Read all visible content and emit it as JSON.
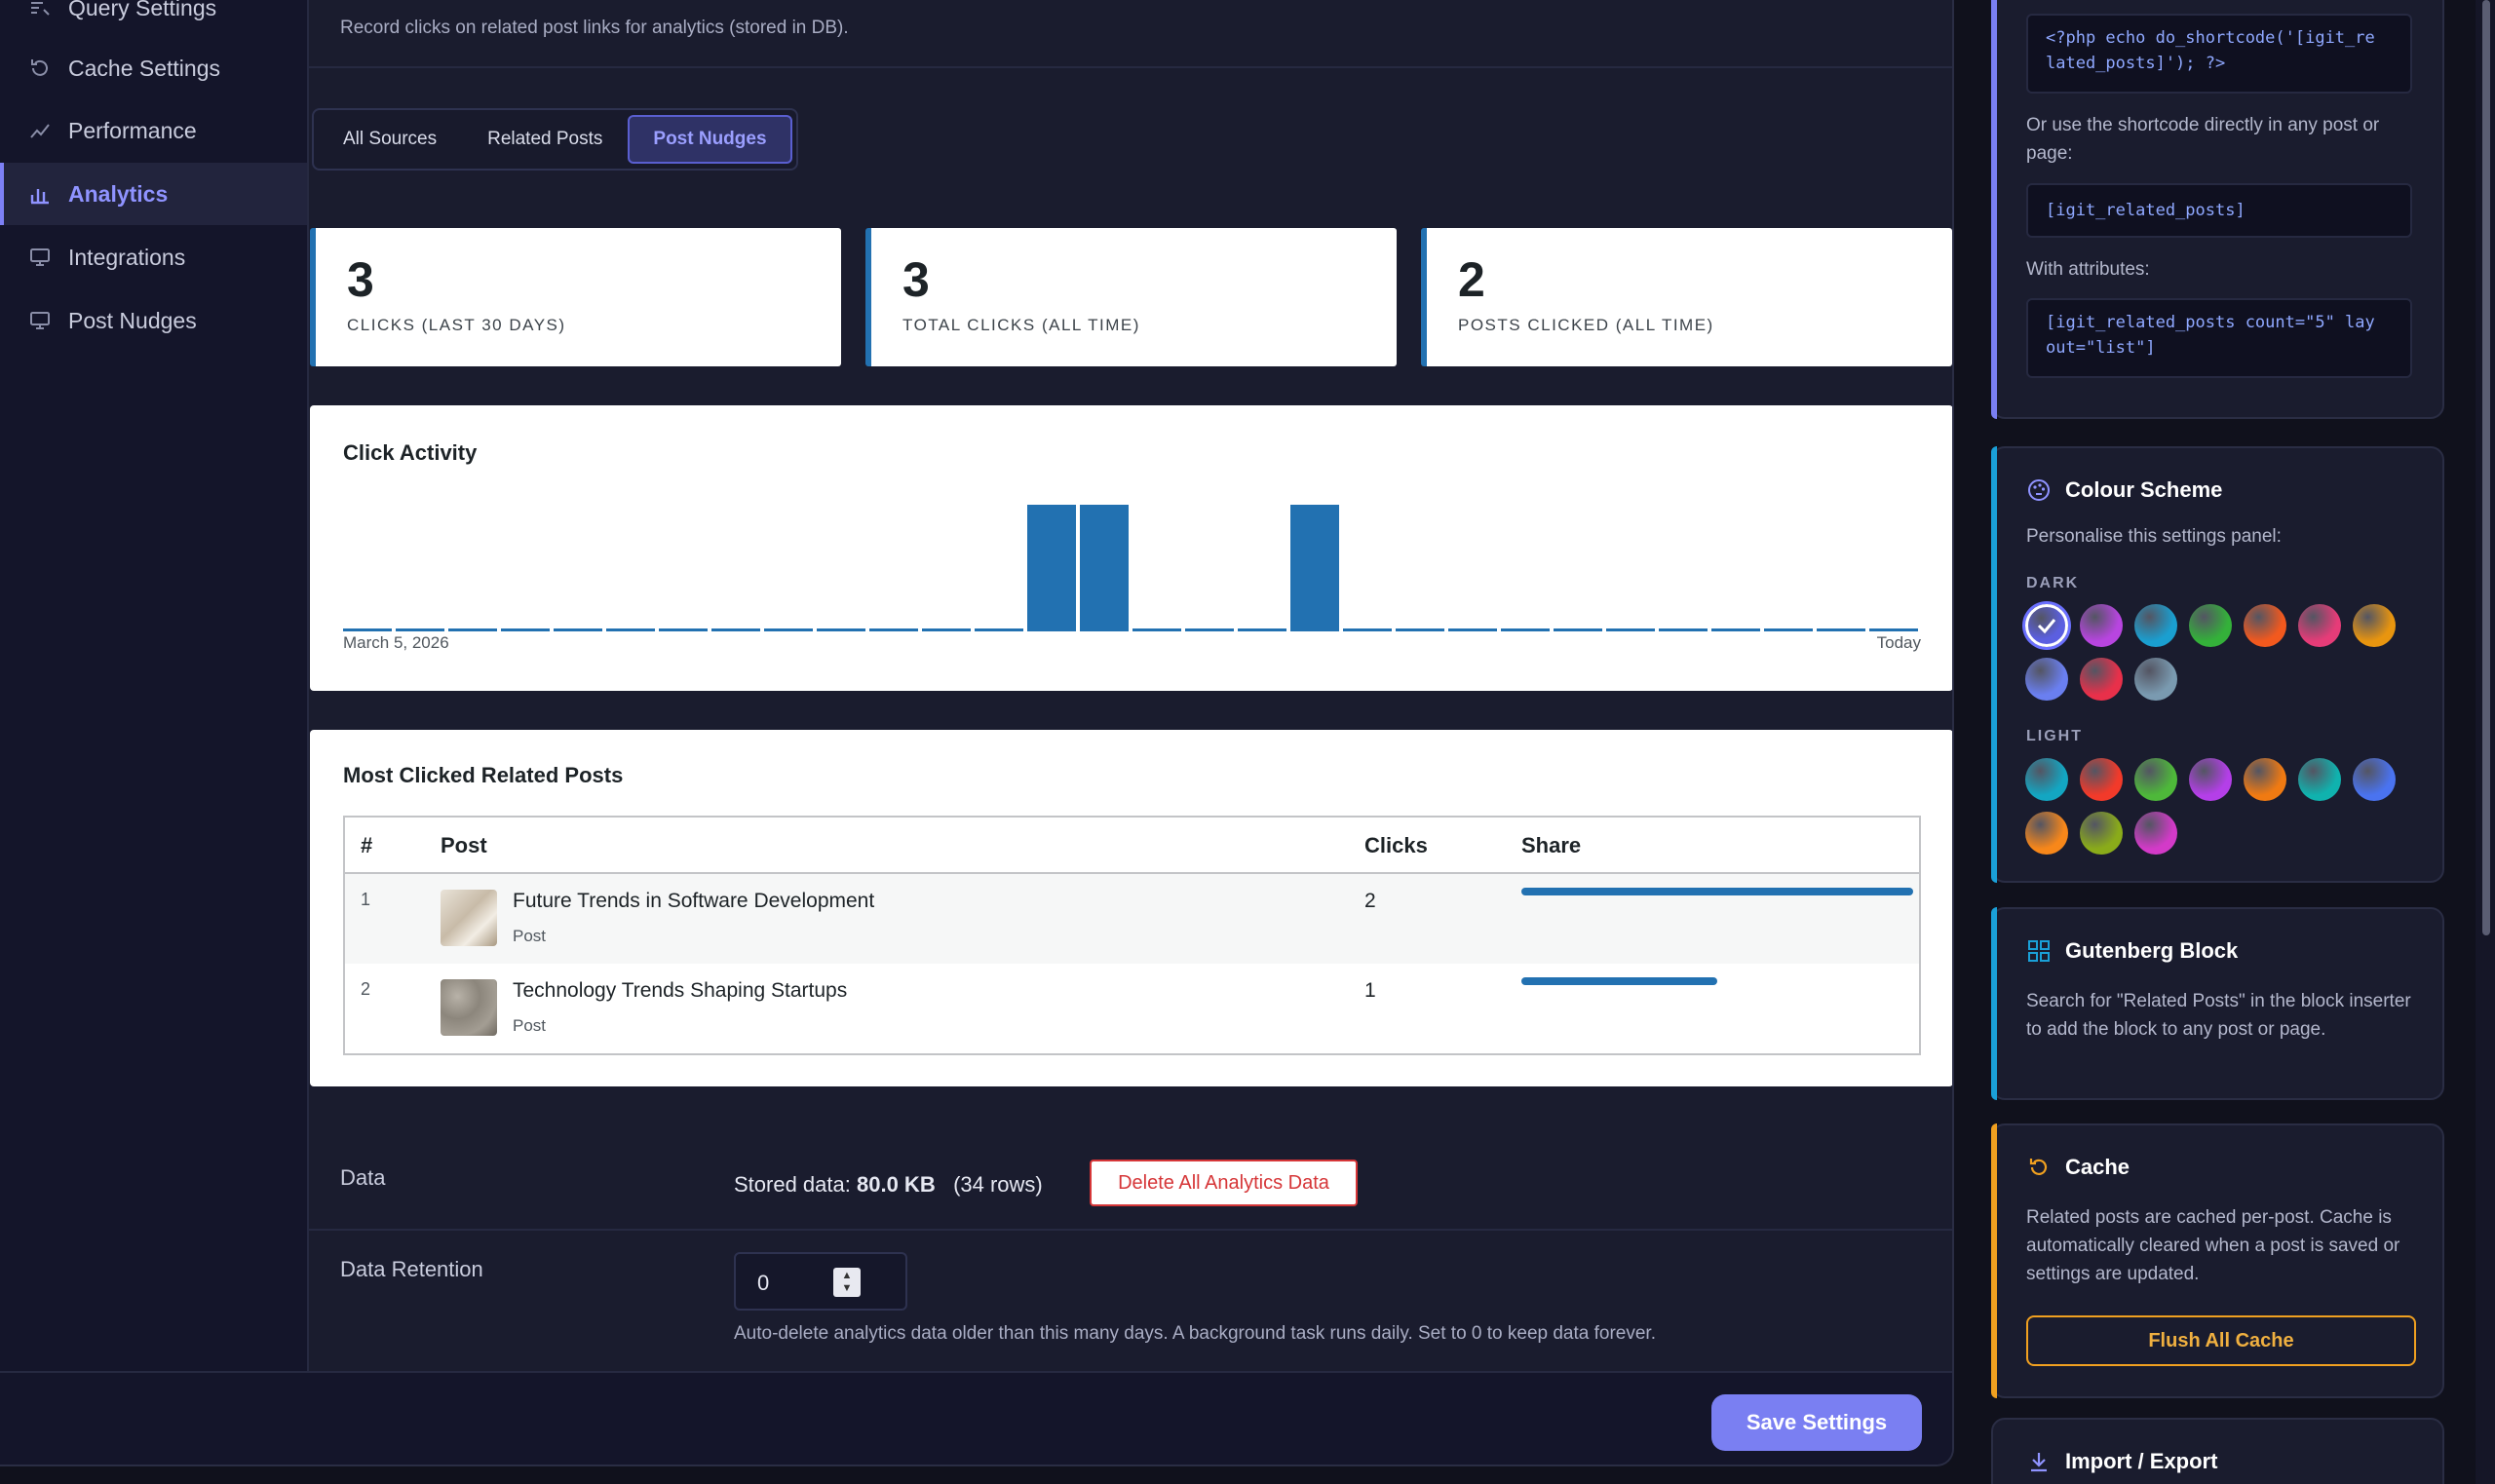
{
  "sidebar": {
    "items": [
      {
        "label": "Query Settings",
        "icon": "query-settings-icon"
      },
      {
        "label": "Cache Settings",
        "icon": "refresh-icon"
      },
      {
        "label": "Performance",
        "icon": "trend-icon"
      },
      {
        "label": "Analytics",
        "icon": "bar-chart-icon",
        "active": true
      },
      {
        "label": "Integrations",
        "icon": "monitor-icon"
      },
      {
        "label": "Post Nudges",
        "icon": "monitor-icon"
      }
    ]
  },
  "main": {
    "description": "Record clicks on related post links for analytics (stored in DB).",
    "tabs": [
      "All Sources",
      "Related Posts",
      "Post Nudges"
    ],
    "active_tab": "Post Nudges",
    "stats": [
      {
        "value": "3",
        "label": "CLICKS (LAST 30 DAYS)"
      },
      {
        "value": "3",
        "label": "TOTAL CLICKS (ALL TIME)"
      },
      {
        "value": "2",
        "label": "POSTS CLICKED (ALL TIME)"
      }
    ],
    "activity": {
      "title": "Click Activity",
      "start_label": "March 5, 2026",
      "end_label": "Today"
    },
    "most_clicked": {
      "title": "Most Clicked Related Posts",
      "columns": [
        "#",
        "Post",
        "Clicks",
        "Share"
      ],
      "rows": [
        {
          "rank": "1",
          "title": "Future Trends in Software Development",
          "type": "Post",
          "clicks": "2",
          "share": 1.0
        },
        {
          "rank": "2",
          "title": "Technology Trends Shaping Startups",
          "type": "Post",
          "clicks": "1",
          "share": 0.5
        }
      ]
    },
    "data_section": {
      "label": "Data",
      "stored_prefix": "Stored data:",
      "stored_size": "80.0 KB",
      "stored_rows": "(34 rows)",
      "delete_label": "Delete All Analytics Data"
    },
    "retention": {
      "label": "Data Retention",
      "value": "0",
      "help": "Auto-delete analytics data older than this many days. A background task runs daily. Set to 0 to keep data forever."
    },
    "save_label": "Save Settings"
  },
  "chart_data": {
    "type": "bar",
    "x": [
      "March 5, 2026",
      "Today"
    ],
    "values": [
      0,
      0,
      0,
      0,
      0,
      0,
      0,
      0,
      0,
      0,
      0,
      0,
      0,
      1,
      1,
      0,
      0,
      0,
      1,
      0,
      0,
      0,
      0,
      0,
      0,
      0,
      0,
      0,
      0,
      0
    ],
    "ylim": [
      0,
      1
    ],
    "grid": false
  },
  "right": {
    "template": {
      "code_php": "<?php echo do_shortcode('[igit_re\nlated_posts]'); ?>",
      "shortcode_intro": "Or use the shortcode directly in any post or page:",
      "code_shortcode": "[igit_related_posts]",
      "attributes_intro": "With attributes:",
      "code_attrs": "[igit_related_posts count=\"5\" lay\nout=\"list\"]"
    },
    "colour_scheme": {
      "title": "Colour Scheme",
      "subtitle": "Personalise this settings panel:",
      "dark_label": "DARK",
      "light_label": "LIGHT",
      "dark_colors": [
        "#5b5fe0",
        "#b845e0",
        "#1a9fd0",
        "#34b13a",
        "#f2591e",
        "#e63c78",
        "#e8950f",
        "#6a7ff0",
        "#e8304a",
        "#7a9ab0"
      ],
      "light_colors": [
        "#13a6c2",
        "#f23a2a",
        "#4eb83a",
        "#b43fe8",
        "#f07a12",
        "#10b2ae",
        "#4a73f0",
        "#f7871a",
        "#8aab1a",
        "#d33ac8"
      ]
    },
    "gutenberg": {
      "title": "Gutenberg Block",
      "text": "Search for \"Related Posts\" in the block inserter to add the block to any post or page."
    },
    "cache": {
      "title": "Cache",
      "text": "Related posts are cached per-post. Cache is automatically cleared when a post is saved or settings are updated.",
      "button": "Flush All Cache"
    },
    "import_export": {
      "title": "Import / Export"
    }
  }
}
